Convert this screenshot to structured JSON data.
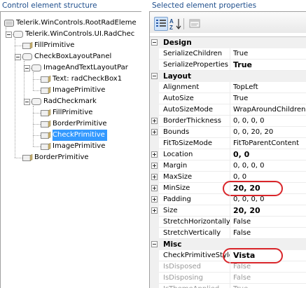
{
  "panels": {
    "tree_title": "Control element structure",
    "grid_title": "Selected element properties"
  },
  "tree": {
    "nodes": [
      {
        "label": "Telerik.WinControls.RootRadEleme",
        "icon": "root-element-icon",
        "expander": false
      },
      {
        "label": "Telerik.WinControls.UI.RadChec",
        "icon": "element-node-icon",
        "expander": true
      },
      {
        "label": "FillPrimitive",
        "icon": "primitive-icon",
        "expander": false
      },
      {
        "label": "CheckBoxLayoutPanel",
        "icon": "element-node-icon",
        "expander": true
      },
      {
        "label": "ImageAndTextLayoutPar",
        "icon": "element-node-icon",
        "expander": true
      },
      {
        "label": "Text: radCheckBox1",
        "icon": "primitive-icon",
        "expander": false
      },
      {
        "label": "ImagePrimitive",
        "icon": "primitive-icon",
        "expander": false
      },
      {
        "label": "RadCheckmark",
        "icon": "element-node-icon",
        "expander": true
      },
      {
        "label": "FillPrimitive",
        "icon": "primitive-icon",
        "expander": false
      },
      {
        "label": "BorderPrimitive",
        "icon": "primitive-icon",
        "expander": false
      },
      {
        "label": "CheckPrimitive",
        "icon": "primitive-icon",
        "expander": false,
        "selected": true
      },
      {
        "label": "ImagePrimitive",
        "icon": "primitive-icon",
        "expander": false
      },
      {
        "label": "BorderPrimitive",
        "icon": "primitive-icon",
        "expander": false
      }
    ]
  },
  "toolbar": {
    "categorized_icon": "categorized-view-icon",
    "alphabetical_icon": "alphabetical-sort-icon",
    "property_pages_icon": "property-pages-icon"
  },
  "grid": {
    "rows": [
      {
        "type": "category",
        "name": "Design"
      },
      {
        "name": "SerializeChildren",
        "value": "True"
      },
      {
        "name": "SerializeProperties",
        "value": "True",
        "bold": true
      },
      {
        "type": "category",
        "name": "Layout"
      },
      {
        "name": "Alignment",
        "value": "TopLeft"
      },
      {
        "name": "AutoSize",
        "value": "True"
      },
      {
        "name": "AutoSizeMode",
        "value": "WrapAroundChildren"
      },
      {
        "name": "BorderThickness",
        "value": "0, 0, 0, 0",
        "expandable": true
      },
      {
        "name": "Bounds",
        "value": "0, 0, 20, 20",
        "expandable": true
      },
      {
        "name": "FitToSizeMode",
        "value": "FitToParentContent"
      },
      {
        "name": "Location",
        "value": "0, 0",
        "expandable": true,
        "bold": true
      },
      {
        "name": "Margin",
        "value": "0, 0, 0, 0",
        "expandable": true
      },
      {
        "name": "MaxSize",
        "value": "0, 0",
        "expandable": true
      },
      {
        "name": "MinSize",
        "value": "20, 20",
        "expandable": true,
        "bold": true,
        "highlight": true
      },
      {
        "name": "Padding",
        "value": "0, 0, 0, 0",
        "expandable": true
      },
      {
        "name": "Size",
        "value": "20, 20",
        "expandable": true,
        "bold": true
      },
      {
        "name": "StretchHorizontally",
        "value": "False"
      },
      {
        "name": "StretchVertically",
        "value": "False"
      },
      {
        "type": "category",
        "name": "Misc"
      },
      {
        "name": "CheckPrimitiveStyle",
        "value": "Vista",
        "bold": true,
        "highlight": true
      },
      {
        "name": "IsDisposed",
        "value": "False",
        "gray": true
      },
      {
        "name": "IsDisposing",
        "value": "False",
        "gray": true
      },
      {
        "name": "IsThemeApplied",
        "value": "True",
        "gray": true
      }
    ]
  },
  "colors": {
    "title_blue": "#1e4e8c",
    "selection": "#3399ff",
    "highlight_ring": "#d9252a"
  }
}
